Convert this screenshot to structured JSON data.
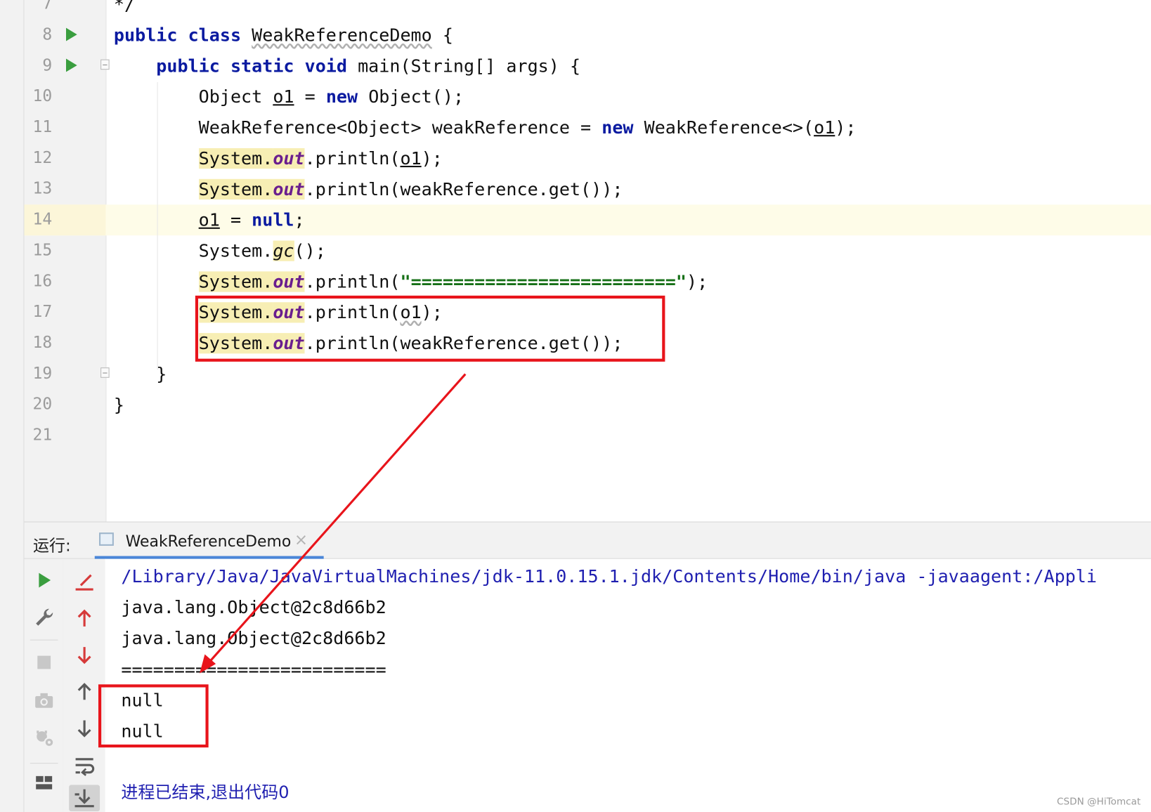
{
  "editor": {
    "lines": [
      {
        "num": "7",
        "segs": [
          [
            "t",
            "*/"
          ]
        ]
      },
      {
        "num": "8",
        "run": true,
        "segs": [
          [
            "kw",
            "public class "
          ],
          [
            "wavy",
            "WeakReferenceDemo"
          ],
          [
            "t",
            " {"
          ]
        ]
      },
      {
        "num": "9",
        "run": true,
        "fold": true,
        "segs": [
          [
            "t",
            "    "
          ],
          [
            "kw",
            "public static void "
          ],
          [
            "t",
            "main(String[] args) {"
          ]
        ]
      },
      {
        "num": "10",
        "segs": [
          [
            "t",
            "        Object "
          ],
          [
            "u",
            "o1"
          ],
          [
            "t",
            " = "
          ],
          [
            "kw",
            "new "
          ],
          [
            "t",
            "Object();"
          ]
        ]
      },
      {
        "num": "11",
        "segs": [
          [
            "t",
            "        WeakReference<Object> weakReference = "
          ],
          [
            "kw",
            "new "
          ],
          [
            "t",
            "WeakReference<>("
          ],
          [
            "u",
            "o1"
          ],
          [
            "t",
            ");"
          ]
        ]
      },
      {
        "num": "12",
        "segs": [
          [
            "t",
            "        "
          ],
          [
            "hl",
            "System."
          ],
          [
            "hlf",
            "out"
          ],
          [
            "t",
            ".println("
          ],
          [
            "u",
            "o1"
          ],
          [
            "t",
            ");"
          ]
        ]
      },
      {
        "num": "13",
        "segs": [
          [
            "t",
            "        "
          ],
          [
            "hl",
            "System."
          ],
          [
            "hlf",
            "out"
          ],
          [
            "t",
            ".println(weakReference.get());"
          ]
        ]
      },
      {
        "num": "14",
        "current": true,
        "segs": [
          [
            "t",
            "        "
          ],
          [
            "u",
            "o1"
          ],
          [
            "t",
            " = "
          ],
          [
            "kw",
            "null"
          ],
          [
            "t",
            ";"
          ]
        ]
      },
      {
        "num": "15",
        "segs": [
          [
            "t",
            "        System."
          ],
          [
            "hlgc",
            "gc"
          ],
          [
            "t",
            "();"
          ]
        ]
      },
      {
        "num": "16",
        "segs": [
          [
            "t",
            "        "
          ],
          [
            "hl",
            "System."
          ],
          [
            "hlf",
            "out"
          ],
          [
            "t",
            ".println("
          ],
          [
            "str",
            "\"=========================\""
          ],
          [
            "t",
            ");"
          ]
        ]
      },
      {
        "num": "17",
        "segs": [
          [
            "t",
            "        "
          ],
          [
            "hl",
            "System."
          ],
          [
            "hlf",
            "out"
          ],
          [
            "t",
            ".println("
          ],
          [
            "wavy",
            "o1"
          ],
          [
            "t",
            ");"
          ]
        ]
      },
      {
        "num": "18",
        "segs": [
          [
            "t",
            "        "
          ],
          [
            "hl",
            "System."
          ],
          [
            "hlf",
            "out"
          ],
          [
            "t",
            ".println(weakReference.get());"
          ]
        ]
      },
      {
        "num": "19",
        "fold": true,
        "segs": [
          [
            "t",
            "    }"
          ]
        ]
      },
      {
        "num": "20",
        "segs": [
          [
            "t",
            "}"
          ]
        ]
      },
      {
        "num": "21",
        "segs": []
      }
    ]
  },
  "run_panel": {
    "label": "运行:",
    "tab_label": "WeakReferenceDemo",
    "close_glyph": "×",
    "console_lines": [
      {
        "kind": "path",
        "text": "/Library/Java/JavaVirtualMachines/jdk-11.0.15.1.jdk/Contents/Home/bin/java -javaagent:/Appli"
      },
      {
        "kind": "out",
        "text": "java.lang.Object@2c8d66b2"
      },
      {
        "kind": "out",
        "text": "java.lang.Object@2c8d66b2"
      },
      {
        "kind": "out",
        "text": "========================="
      },
      {
        "kind": "out",
        "text": "null"
      },
      {
        "kind": "out",
        "text": "null"
      },
      {
        "kind": "out",
        "text": ""
      },
      {
        "kind": "exit",
        "text": "进程已结束,退出代码0"
      }
    ]
  },
  "toolbar_icons": {
    "left": [
      "run-icon",
      "wrench-icon",
      "stop-icon",
      "camera-icon",
      "debug-settings-icon",
      "layout-icon"
    ],
    "right": [
      "clear-icon",
      "up-red-icon",
      "down-red-icon",
      "up-icon",
      "down-icon",
      "soft-wrap-icon",
      "scroll-to-end-icon"
    ]
  },
  "colors": {
    "annotation_red": "#e8141b",
    "keyword": "#0a1aa0",
    "run_green": "#3a9e3f",
    "console_path": "#1f1fb0"
  },
  "watermark": "CSDN @HiTomcat"
}
